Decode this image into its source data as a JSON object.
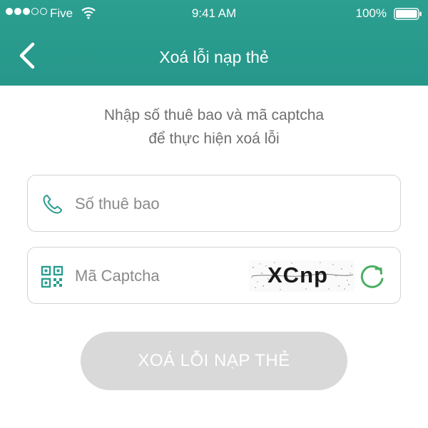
{
  "status_bar": {
    "carrier": "Five",
    "time": "9:41 AM",
    "battery": "100%",
    "signal_bars_filled": 3,
    "signal_bars_total": 5
  },
  "nav": {
    "title": "Xoá lỗi nạp thẻ",
    "back_icon": "chevron-left-icon"
  },
  "intro": {
    "line1": "Nhập số thuê bao và mã captcha",
    "line2": "để thực hiện xoá lỗi"
  },
  "form": {
    "phone": {
      "placeholder": "Số thuê bao",
      "value": "",
      "icon": "phone-icon"
    },
    "captcha": {
      "placeholder": "Mã Captcha",
      "value": "",
      "icon": "qr-code-icon",
      "image_text": "XCnp",
      "refresh_icon": "refresh-icon"
    },
    "submit_label": "XOÁ LỖI NẠP THẺ"
  },
  "colors": {
    "header": "#2a9d8f",
    "icon_accent": "#2a9d8f",
    "refresh": "#4cae63",
    "button_disabled": "#d9d9d9"
  }
}
